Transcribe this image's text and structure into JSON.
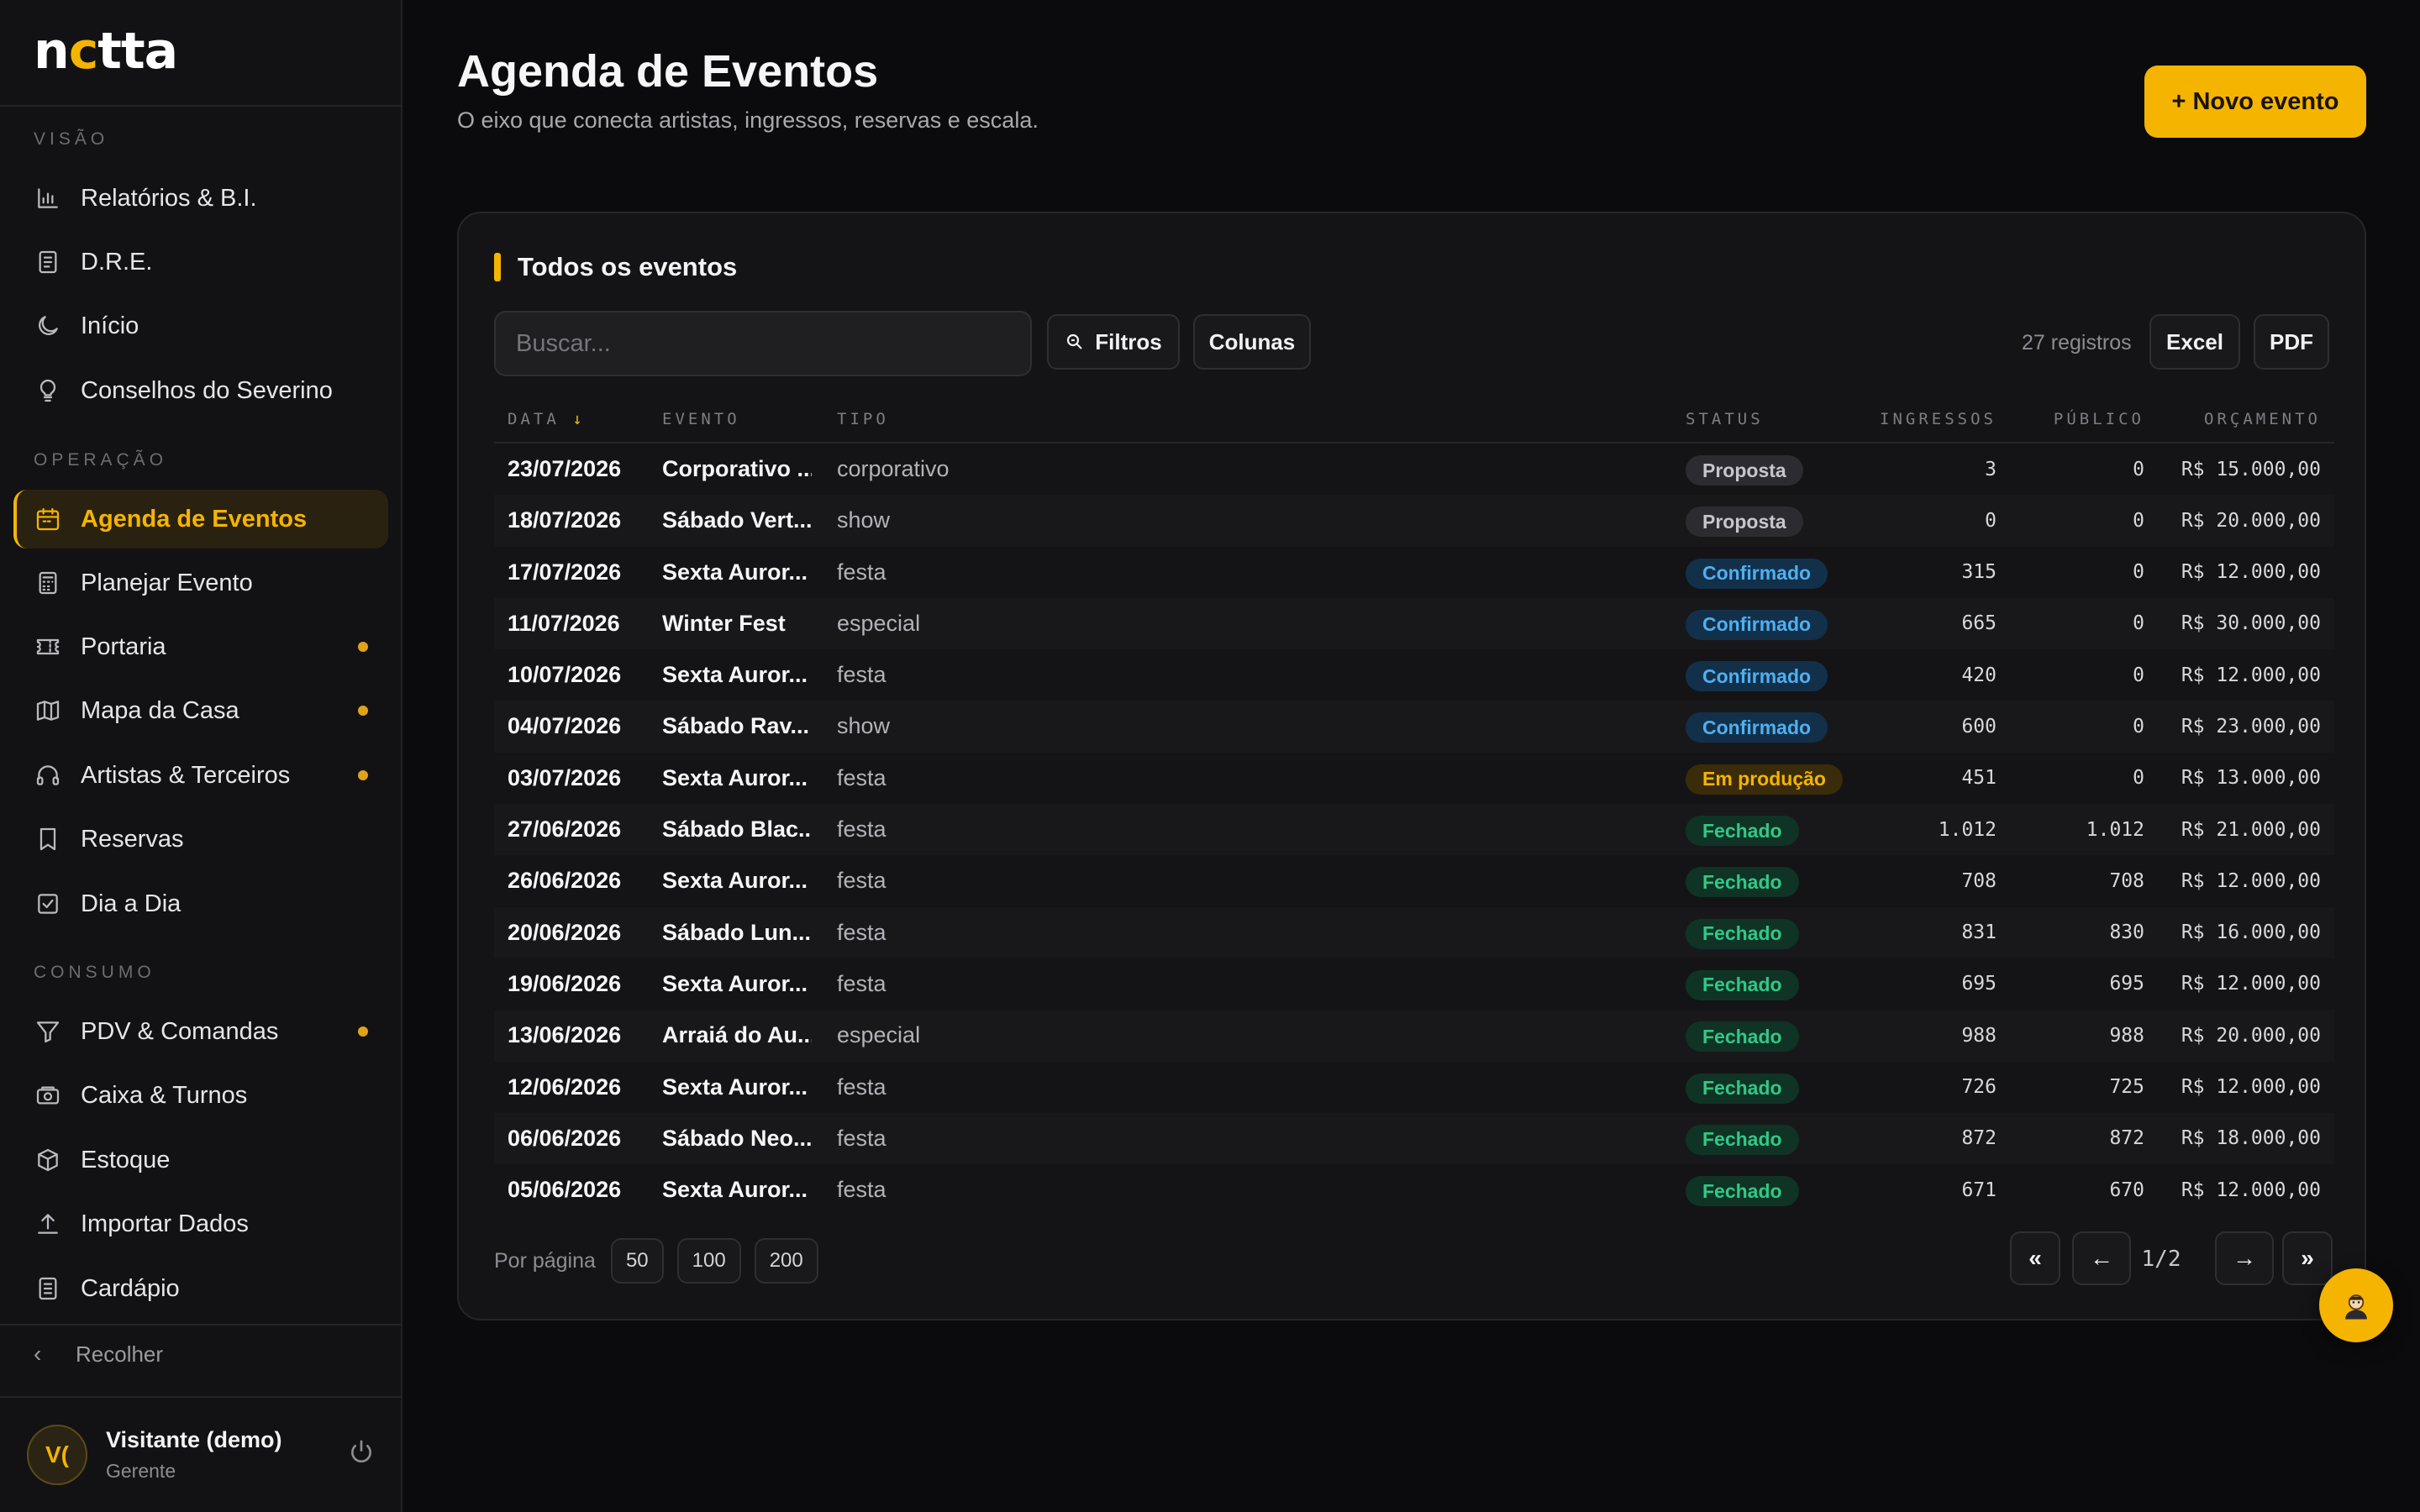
{
  "brand": {
    "logo_pre": "n",
    "logo_moon": "c",
    "logo_post": "tta"
  },
  "sidebar": {
    "sections": [
      "VISÃO",
      "OPERAÇÃO",
      "CONSUMO"
    ],
    "items": [
      {
        "label": "Relatórios & B.I.",
        "icon": "bar-chart-icon"
      },
      {
        "label": "D.R.E.",
        "icon": "document-icon"
      },
      {
        "label": "Início",
        "icon": "moon-icon"
      },
      {
        "label": "Conselhos do Severino",
        "icon": "lightbulb-icon"
      },
      {
        "label": "Agenda de Eventos",
        "icon": "calendar-icon",
        "active": true
      },
      {
        "label": "Planejar Evento",
        "icon": "calculator-icon"
      },
      {
        "label": "Portaria",
        "icon": "ticket-icon",
        "dot": true
      },
      {
        "label": "Mapa da Casa",
        "icon": "map-icon",
        "dot": true
      },
      {
        "label": "Artistas & Terceiros",
        "icon": "headphones-icon",
        "dot": true
      },
      {
        "label": "Reservas",
        "icon": "bookmark-icon"
      },
      {
        "label": "Dia a Dia",
        "icon": "checkbox-icon"
      },
      {
        "label": "PDV & Comandas",
        "icon": "filter-icon",
        "dot": true
      },
      {
        "label": "Caixa & Turnos",
        "icon": "cash-icon"
      },
      {
        "label": "Estoque",
        "icon": "box-icon"
      },
      {
        "label": "Importar Dados",
        "icon": "upload-icon"
      },
      {
        "label": "Cardápio",
        "icon": "menu-book-icon"
      }
    ],
    "collapse_label": "Recolher"
  },
  "user": {
    "initials": "V(",
    "name": "Visitante (demo)",
    "role": "Gerente"
  },
  "header": {
    "title": "Agenda de Eventos",
    "subtitle": "O eixo que conecta artistas, ingressos, reservas e escala.",
    "new_button": "+ Novo evento"
  },
  "card": {
    "title": "Todos os eventos",
    "search_placeholder": "Buscar...",
    "filters_label": "Filtros",
    "columns_label": "Colunas",
    "records": "27 registros",
    "excel_label": "Excel",
    "pdf_label": "PDF"
  },
  "table": {
    "columns": {
      "date": "DATA",
      "date_sort": "↓",
      "event": "EVENTO",
      "type": "TIPO",
      "status": "STATUS",
      "tickets": "INGRESSOS",
      "audience": "PÚBLICO",
      "budget": "ORÇAMENTO"
    },
    "rows": [
      {
        "date": "23/07/2026",
        "event": "Corporativo ...",
        "type": "corporativo",
        "status": "Proposta",
        "kind": "proposta",
        "tickets": "3",
        "audience": "0",
        "budget": "R$ 15.000,00"
      },
      {
        "date": "18/07/2026",
        "event": "Sábado Vert...",
        "type": "show",
        "status": "Proposta",
        "kind": "proposta",
        "tickets": "0",
        "audience": "0",
        "budget": "R$ 20.000,00"
      },
      {
        "date": "17/07/2026",
        "event": "Sexta Auror...",
        "type": "festa",
        "status": "Confirmado",
        "kind": "confirmado",
        "tickets": "315",
        "audience": "0",
        "budget": "R$ 12.000,00"
      },
      {
        "date": "11/07/2026",
        "event": "Winter Fest",
        "type": "especial",
        "status": "Confirmado",
        "kind": "confirmado",
        "tickets": "665",
        "audience": "0",
        "budget": "R$ 30.000,00"
      },
      {
        "date": "10/07/2026",
        "event": "Sexta Auror...",
        "type": "festa",
        "status": "Confirmado",
        "kind": "confirmado",
        "tickets": "420",
        "audience": "0",
        "budget": "R$ 12.000,00"
      },
      {
        "date": "04/07/2026",
        "event": "Sábado Rav...",
        "type": "show",
        "status": "Confirmado",
        "kind": "confirmado",
        "tickets": "600",
        "audience": "0",
        "budget": "R$ 23.000,00"
      },
      {
        "date": "03/07/2026",
        "event": "Sexta Auror...",
        "type": "festa",
        "status": "Em produção",
        "kind": "producao",
        "tickets": "451",
        "audience": "0",
        "budget": "R$ 13.000,00"
      },
      {
        "date": "27/06/2026",
        "event": "Sábado Blac...",
        "type": "festa",
        "status": "Fechado",
        "kind": "fechado",
        "tickets": "1.012",
        "audience": "1.012",
        "budget": "R$ 21.000,00"
      },
      {
        "date": "26/06/2026",
        "event": "Sexta Auror...",
        "type": "festa",
        "status": "Fechado",
        "kind": "fechado",
        "tickets": "708",
        "audience": "708",
        "budget": "R$ 12.000,00"
      },
      {
        "date": "20/06/2026",
        "event": "Sábado Lun...",
        "type": "festa",
        "status": "Fechado",
        "kind": "fechado",
        "tickets": "831",
        "audience": "830",
        "budget": "R$ 16.000,00"
      },
      {
        "date": "19/06/2026",
        "event": "Sexta Auror...",
        "type": "festa",
        "status": "Fechado",
        "kind": "fechado",
        "tickets": "695",
        "audience": "695",
        "budget": "R$ 12.000,00"
      },
      {
        "date": "13/06/2026",
        "event": "Arraiá do Au...",
        "type": "especial",
        "status": "Fechado",
        "kind": "fechado",
        "tickets": "988",
        "audience": "988",
        "budget": "R$ 20.000,00"
      },
      {
        "date": "12/06/2026",
        "event": "Sexta Auror...",
        "type": "festa",
        "status": "Fechado",
        "kind": "fechado",
        "tickets": "726",
        "audience": "725",
        "budget": "R$ 12.000,00"
      },
      {
        "date": "06/06/2026",
        "event": "Sábado Neo...",
        "type": "festa",
        "status": "Fechado",
        "kind": "fechado",
        "tickets": "872",
        "audience": "872",
        "budget": "R$ 18.000,00"
      },
      {
        "date": "05/06/2026",
        "event": "Sexta Auror...",
        "type": "festa",
        "status": "Fechado",
        "kind": "fechado",
        "tickets": "671",
        "audience": "670",
        "budget": "R$ 12.000,00"
      }
    ]
  },
  "pagination": {
    "per_page_label": "Por página",
    "sizes": [
      "50",
      "100",
      "200"
    ],
    "first": "«",
    "prev": "←",
    "page": "1/2",
    "next": "→",
    "last": "»"
  },
  "colors": {
    "accent": "#f5b400",
    "background": "#0b0b0d",
    "confirmed": "#4fb0f0",
    "closed": "#33c787"
  }
}
